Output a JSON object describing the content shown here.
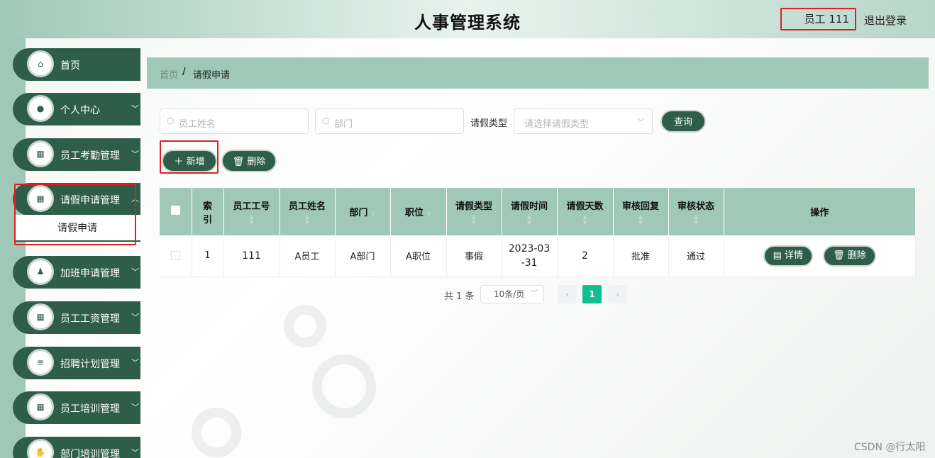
{
  "header": {
    "title": "人事管理系统",
    "user": "员工 111",
    "logout": "退出登录"
  },
  "sidebar": {
    "items": [
      {
        "label": "首页",
        "icon": "home-icon",
        "has_chevron": false
      },
      {
        "label": "个人中心",
        "icon": "user-icon",
        "has_chevron": true
      },
      {
        "label": "员工考勤管理",
        "icon": "grid-icon",
        "has_chevron": true
      },
      {
        "label": "请假申请管理",
        "icon": "grid-icon",
        "has_chevron": true,
        "expanded": true
      },
      {
        "label": "加班申请管理",
        "icon": "person-icon",
        "has_chevron": true
      },
      {
        "label": "员工工资管理",
        "icon": "grid-icon",
        "has_chevron": true
      },
      {
        "label": "招聘计划管理",
        "icon": "list-icon",
        "has_chevron": true
      },
      {
        "label": "员工培训管理",
        "icon": "grid-icon",
        "has_chevron": true
      },
      {
        "label": "部门培训管理",
        "icon": "hand-icon",
        "has_chevron": true
      }
    ],
    "submenu": "请假申请"
  },
  "breadcrumb": {
    "home": "首页",
    "separator": "/",
    "current": "请假申请"
  },
  "search": {
    "name_placeholder": "员工姓名",
    "dept_placeholder": "部门",
    "type_label": "请假类型",
    "type_placeholder": "请选择请假类型",
    "query_button": "查询"
  },
  "actions": {
    "add": "新增",
    "delete": "删除"
  },
  "table": {
    "headers": [
      "索引",
      "员工工号",
      "员工姓名",
      "部门",
      "职位",
      "请假类型",
      "请假时间",
      "请假天数",
      "审核回复",
      "审核状态",
      "操作"
    ],
    "index_header_line1": "索",
    "index_header_line2": "引",
    "rows": [
      {
        "index": "1",
        "emp_no": "111",
        "emp_name": "A员工",
        "dept": "A部门",
        "position": "A职位",
        "leave_type": "事假",
        "leave_time_line1": "2023-03",
        "leave_time_line2": "-31",
        "days": "2",
        "reply": "批准",
        "status": "通过",
        "detail_btn": "详情",
        "delete_btn": "删除"
      }
    ]
  },
  "pagination": {
    "total": "共 1 条",
    "page_size": "10条/页",
    "current_page": "1"
  },
  "watermark": "CSDN @行太阳",
  "colors": {
    "primary": "#2e5e4a",
    "accent": "#9fc8b8",
    "highlight_frame": "#e02020",
    "page_active": "#0fbf8f"
  }
}
